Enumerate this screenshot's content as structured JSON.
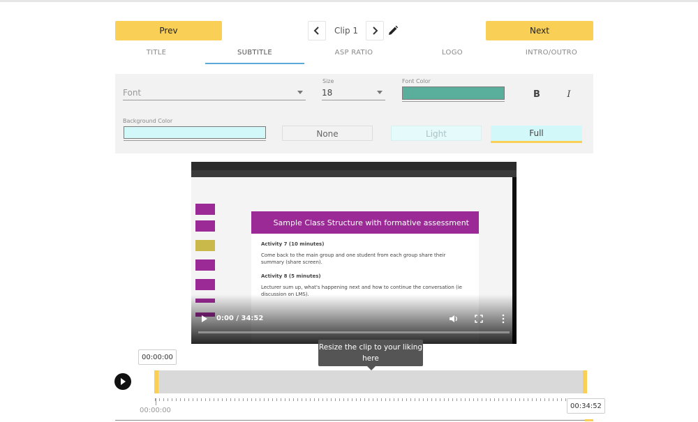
{
  "header": {
    "prev_label": "Prev",
    "next_label": "Next",
    "clip_label": "Clip 1"
  },
  "tabs": [
    {
      "label": "TITLE"
    },
    {
      "label": "SUBTITLE",
      "active": true
    },
    {
      "label": "ASP RATIO"
    },
    {
      "label": "LOGO"
    },
    {
      "label": "INTRO/OUTRO"
    }
  ],
  "panel": {
    "font": {
      "placeholder": "Font"
    },
    "size": {
      "label": "Size",
      "value": "18"
    },
    "font_color": {
      "label": "Font Color",
      "value": "#5aaf9c"
    },
    "bold_label": "B",
    "italic_label": "I",
    "background": {
      "label": "Background Color",
      "value": "#d2f8fa"
    },
    "bg_options": [
      {
        "label": "None"
      },
      {
        "label": "Light"
      },
      {
        "label": "Full",
        "selected": true
      }
    ]
  },
  "video": {
    "slide_title": "Sample Class Structure with formative assessment",
    "activity7_title": "Activity 7 (10 minutes)",
    "activity7_body": "Come back to the main group and one student from each group share their summary (share screen).",
    "activity8_title": "Activity 8 (5 minutes)",
    "activity8_body": "Lecturer sum up, what's happening next and how to continue the conversation (ie discussion on LMS).",
    "time_display": "0:00 / 34:52"
  },
  "timeline": {
    "start_box": "00:00:00",
    "tooltip": "Resize the clip to your liking here",
    "start_label": "00:00:00",
    "end_box": "00:34:52"
  },
  "colors": {
    "accent_yellow": "#f9cf55",
    "tab_underline": "#5aa9d6",
    "slide_purple": "#9b2a96"
  }
}
